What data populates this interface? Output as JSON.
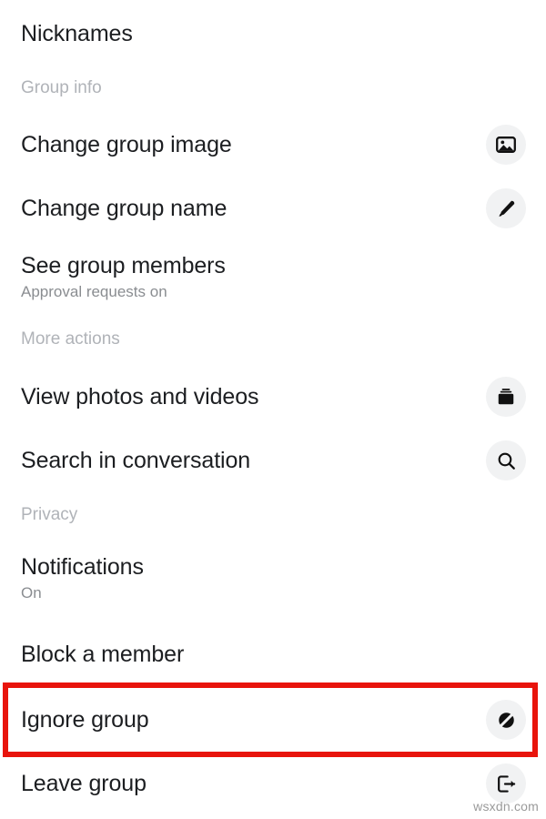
{
  "screen": {
    "title": "Group chat details menu",
    "background_color": "#ffffff",
    "highlight_color": "#e8140c",
    "icon_circle_color": "#f1f2f3",
    "text_color": "#1c1e21",
    "muted_text_color": "#8a8d91",
    "section_header_color": "#b0b3b8"
  },
  "rows": [
    {
      "id": "nicknames",
      "label": "Nicknames",
      "subtitle": null,
      "icon": null,
      "highlighted": false
    },
    {
      "id": "change-group-image",
      "label": "Change group image",
      "subtitle": null,
      "icon": "image-icon",
      "highlighted": false
    },
    {
      "id": "change-group-name",
      "label": "Change group name",
      "subtitle": null,
      "icon": "pencil-icon",
      "highlighted": false
    },
    {
      "id": "see-group-members",
      "label": "See group members",
      "subtitle": "Approval requests on",
      "icon": null,
      "highlighted": false
    },
    {
      "id": "view-photos-and-videos",
      "label": "View photos and videos",
      "subtitle": null,
      "icon": "media-stack-icon",
      "highlighted": false
    },
    {
      "id": "search-in-conversation",
      "label": "Search in conversation",
      "subtitle": null,
      "icon": "search-icon",
      "highlighted": false
    },
    {
      "id": "notifications",
      "label": "Notifications",
      "subtitle": "On",
      "icon": null,
      "highlighted": false
    },
    {
      "id": "block-a-member",
      "label": "Block a member",
      "subtitle": null,
      "icon": null,
      "highlighted": false
    },
    {
      "id": "ignore-group",
      "label": "Ignore group",
      "subtitle": null,
      "icon": "ignore-slash-icon",
      "highlighted": true
    },
    {
      "id": "leave-group",
      "label": "Leave group",
      "subtitle": null,
      "icon": "exit-icon",
      "highlighted": false
    }
  ],
  "section_headers": [
    {
      "id": "group-info",
      "label": "Group info"
    },
    {
      "id": "more-actions",
      "label": "More actions"
    },
    {
      "id": "privacy",
      "label": "Privacy"
    }
  ],
  "watermark": {
    "text": "wsxdn.com"
  }
}
